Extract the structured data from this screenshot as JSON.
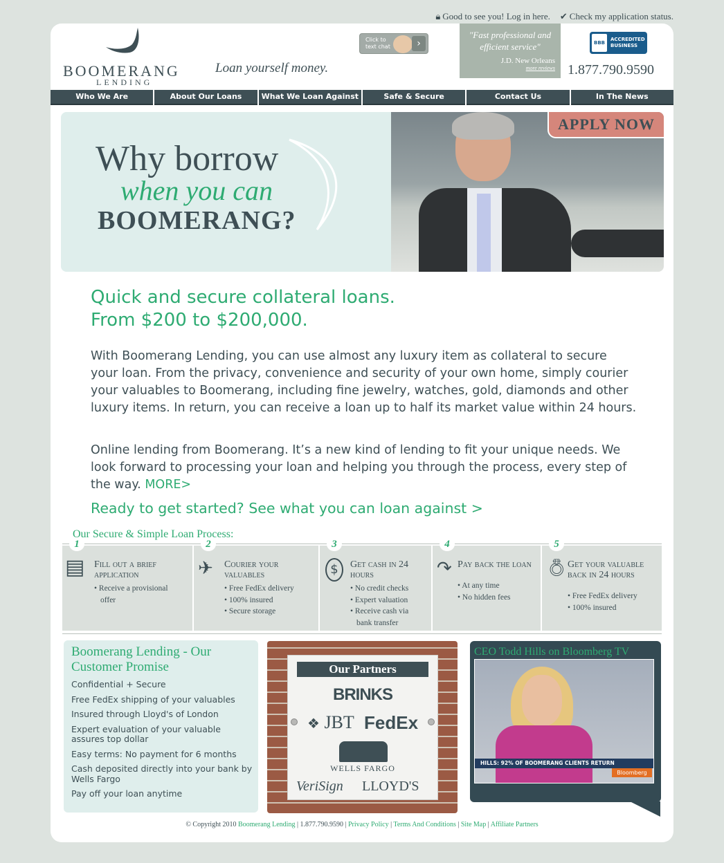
{
  "top_links": {
    "login": "Good to see you! Log in here.",
    "status": "Check my application status."
  },
  "header": {
    "logo_name": "BOOMERANG",
    "logo_sub": "LENDING",
    "tagline": "Loan yourself money.",
    "chat_button": "Click to text chat",
    "quote_text": "\"Fast professional and efficient service\"",
    "quote_source": "J.D. New Orleans",
    "quote_more": "more reviews",
    "bbb_badge": "BBB",
    "bbb_text": "ACCREDITED BUSINESS",
    "phone": "1.877.790.9590"
  },
  "nav": [
    "Who We Are",
    "About Our Loans",
    "What We Loan Against",
    "Safe & Secure",
    "Contact Us",
    "In The News"
  ],
  "hero": {
    "line1": "Why borrow",
    "line2": "when you can",
    "line3": "BOOMERANG?",
    "apply": "APPLY NOW"
  },
  "intro": {
    "headline1": "Quick and secure collateral loans.",
    "headline2": "From $200 to $200,000.",
    "p1": "With Boomerang Lending, you can use almost any luxury item as collateral to secure your loan. From the privacy, convenience and security of your own home, simply courier your valuables to Boomerang, including fine jewelry, watches, gold, diamonds and other luxury items. In return, you can receive a loan up to half its market value within 24 hours.",
    "p2": "Online lending from Boomerang. It’s a new kind of lending to fit your unique needs. We look forward to processing your loan and helping you through the process, every step of the way.",
    "more": "MORE>",
    "ready": "Ready to get started? See what you can loan against >"
  },
  "process": {
    "title": "Our Secure & Simple Loan Process:",
    "steps": [
      {
        "num": "1",
        "title": "Fill out a brief application",
        "items": [
          "• Receive a provisional",
          "offer"
        ]
      },
      {
        "num": "2",
        "title": "Courier your valuables",
        "items": [
          "• Free FedEx delivery",
          "• 100% insured",
          "• Secure storage"
        ]
      },
      {
        "num": "3",
        "title": "Get cash in 24 hours",
        "items": [
          "• No credit checks",
          "• Expert valuation",
          "• Receive cash via",
          "bank transfer"
        ]
      },
      {
        "num": "4",
        "title": "Pay back the loan",
        "items": [
          "• At any time",
          "• No hidden fees"
        ]
      },
      {
        "num": "5",
        "title": "Get your valuable back in 24 hours",
        "items": [
          "• Free FedEx delivery",
          "• 100% insured"
        ]
      }
    ]
  },
  "promise": {
    "title": "Boomerang Lending - Our Customer Promise",
    "items": [
      "Confidential + Secure",
      "Free FedEx shipping of your valuables",
      "Insured through Lloyd's of London",
      "Expert evaluation of your valuable assures top dollar",
      "Easy terms: No payment for 6 months",
      "Cash deposited directly into your bank by Wells Fargo",
      "Pay off your loan anytime"
    ]
  },
  "partners": {
    "title": "Our Partners",
    "brinks": "BRINKS",
    "jbt": "JBT",
    "fedex": "FedEx",
    "wells": "WELLS FARGO",
    "verisign": "VeriSign",
    "lloyds": "LLOYD'S"
  },
  "tv": {
    "title": "CEO Todd Hills on Bloomberg TV",
    "ticker": "HILLS: 92% OF BOOMERANG CLIENTS RETURN",
    "network": "Bloomberg"
  },
  "footer": {
    "copyright": "© Copyright 2010",
    "brand": "Boomerang Lending",
    "phone": "1.877.790.9590",
    "links": [
      "Privacy Policy",
      "Terms And Conditions",
      "Site Map",
      "Affiliate Partners"
    ]
  }
}
